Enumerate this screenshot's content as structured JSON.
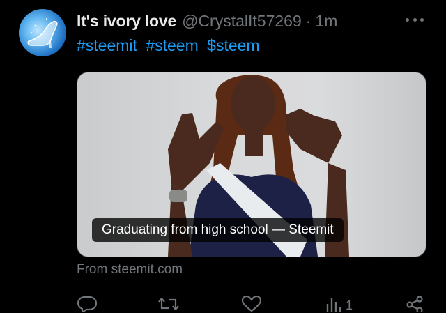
{
  "tweet": {
    "author_name": "It's ivory love",
    "handle": "@CrystalIt57269",
    "separator": "·",
    "time": "1m",
    "hashtags": [
      "#steemit",
      "#steem",
      "$steem"
    ]
  },
  "card": {
    "caption": "Graduating from high school — Steemit",
    "source": "From steemit.com"
  },
  "actions": {
    "views_count": "1"
  },
  "icons": {
    "avatar": "glass-slipper-avatar",
    "more": "more-dots-icon",
    "reply": "reply-icon",
    "retweet": "retweet-icon",
    "like": "like-icon",
    "views": "views-icon",
    "share": "share-icon"
  },
  "colors": {
    "background": "#000000",
    "text": "#e7e9ea",
    "muted": "#71767b",
    "accent": "#1d9bf0"
  }
}
